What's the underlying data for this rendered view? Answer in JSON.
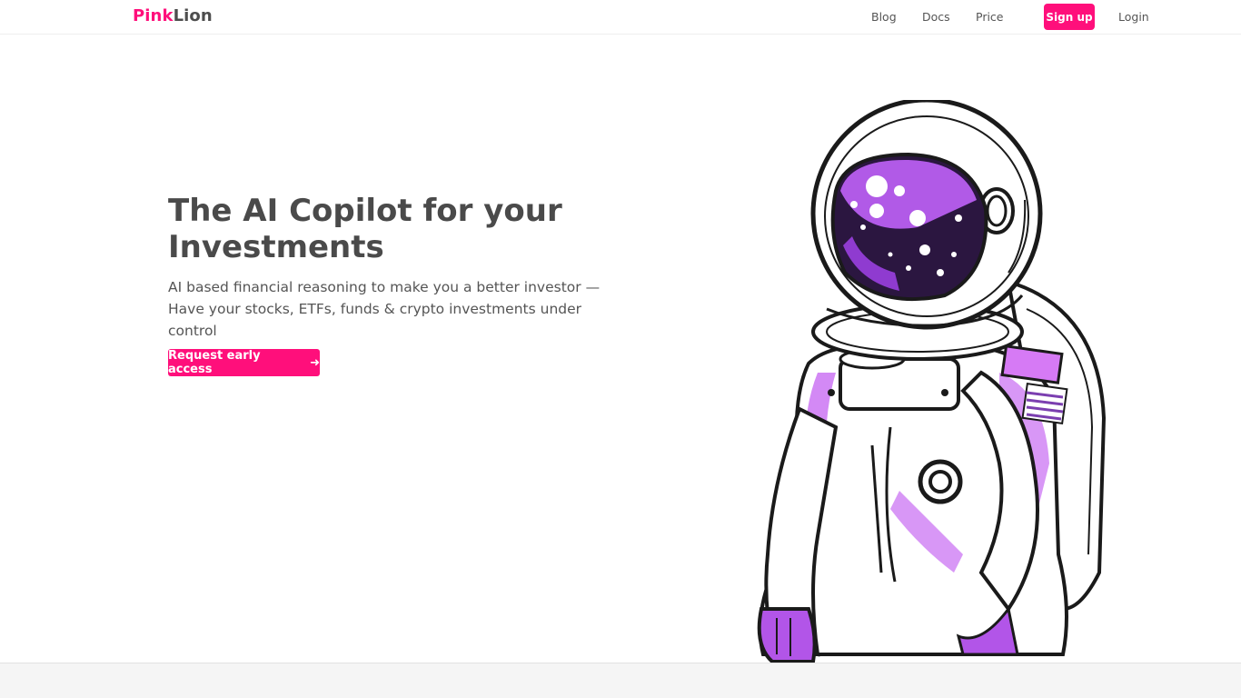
{
  "brand": {
    "name_part1": "Pink",
    "name_part2": "Lion",
    "accent": "#ff0f7b"
  },
  "nav": {
    "blog": "Blog",
    "docs": "Docs",
    "price": "Price",
    "signup": "Sign up",
    "login": "Login"
  },
  "hero": {
    "title": "The AI Copilot for your Investments",
    "subtitle": "AI based financial reasoning to make you a better investor — Have your stocks, ETFs, funds & crypto investments under control",
    "cta_label": "Request early access",
    "cta_icon": "arrow-right-icon",
    "illustration": "astronaut-illustration"
  }
}
